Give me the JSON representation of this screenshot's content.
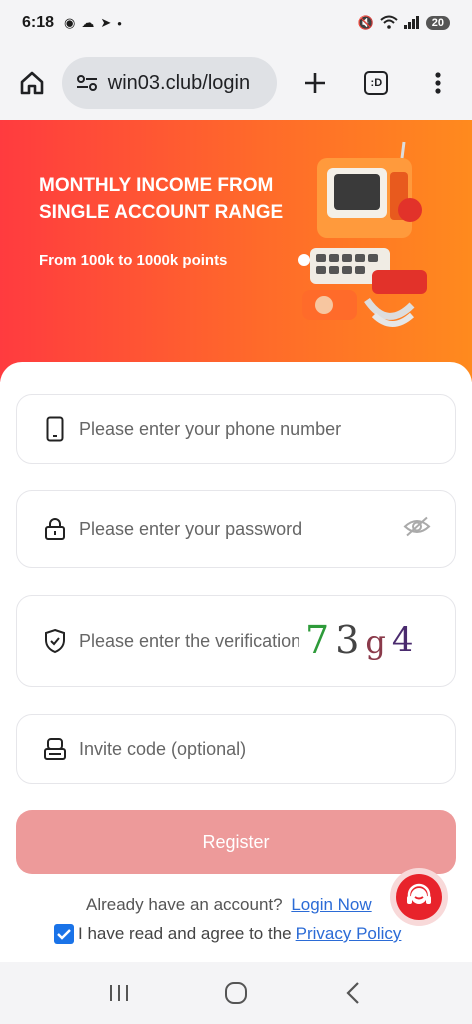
{
  "status_bar": {
    "time": "6:18",
    "battery": "20"
  },
  "browser": {
    "url": "win03.club/login",
    "tabs_label": ":D"
  },
  "banner": {
    "title": "MONTHLY INCOME FROM SINGLE ACCOUNT RANGE",
    "subtitle": "From 100k to 1000k points"
  },
  "form": {
    "phone_placeholder": "Please enter your phone number",
    "password_placeholder": "Please enter your password",
    "verification_placeholder": "Please enter the verification code",
    "captcha": [
      "7",
      "3",
      "g",
      "4"
    ],
    "invite_placeholder": "Invite code (optional)",
    "register_label": "Register"
  },
  "footer": {
    "have_account": "Already have an account?",
    "login_link": "Login Now",
    "agree_text": "I have read and agree to the",
    "privacy_link": "Privacy Policy",
    "agree_checked": true
  },
  "colors": {
    "banner_start": "#ff3b3f",
    "banner_end": "#ff8a1e",
    "register_bg": "#ed9a9a",
    "link": "#2b6bd6"
  }
}
